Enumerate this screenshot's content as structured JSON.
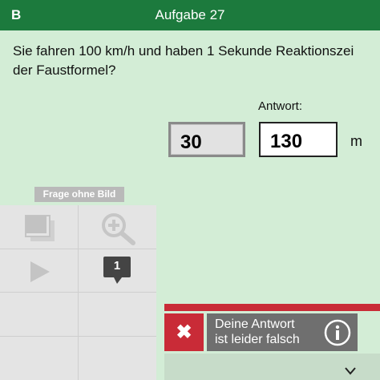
{
  "header": {
    "class_label": "B",
    "title": "Aufgabe 27"
  },
  "question": {
    "line1": "Sie fahren 100 km/h und haben 1 Sekunde Reaktionszei",
    "line2": "der Faustformel?"
  },
  "answer": {
    "label": "Antwort:",
    "value1": "30",
    "value2": "130",
    "unit": "m"
  },
  "media": {
    "no_image_label": "Frage ohne Bild",
    "comment_count": "1"
  },
  "feedback": {
    "line1": "Deine Antwort",
    "line2": "ist leider falsch",
    "close_icon": "x-icon",
    "info_icon": "info-icon"
  },
  "colors": {
    "header": "#1c7a3d",
    "background": "#d3edd6",
    "error": "#c92b37"
  }
}
